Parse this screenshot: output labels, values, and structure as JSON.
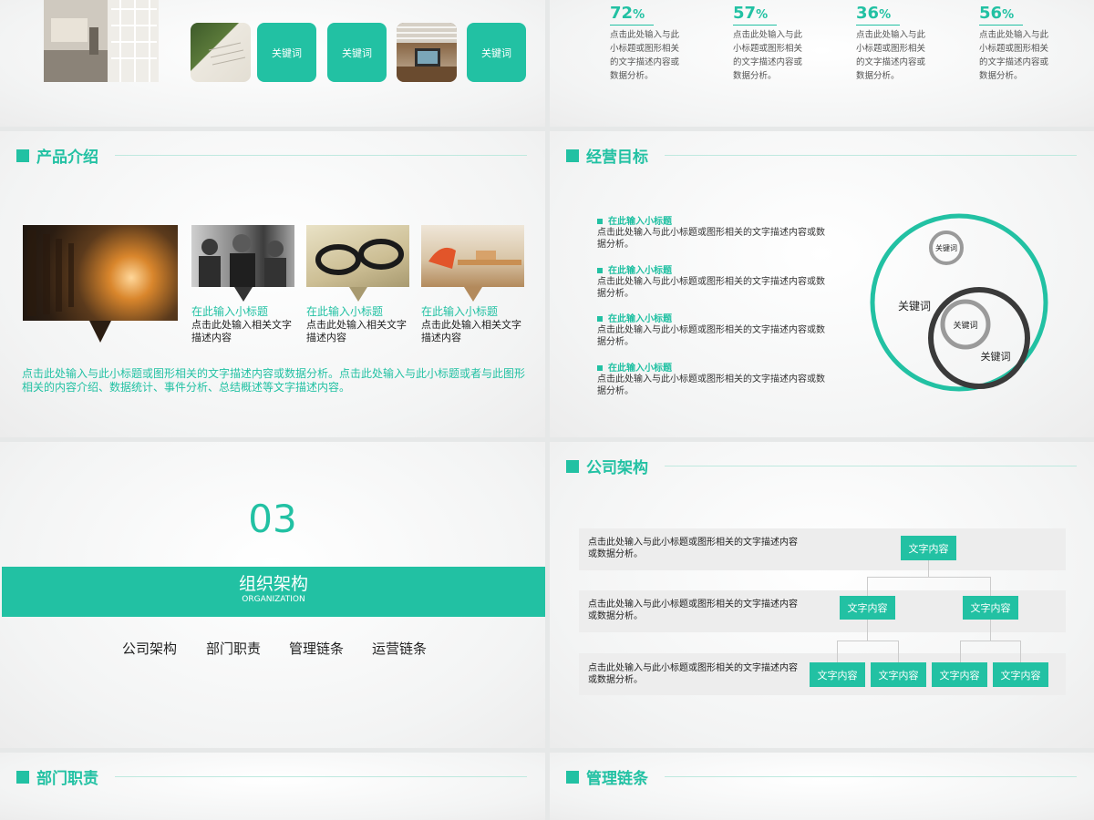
{
  "slide1": {
    "keywords": [
      "关键词",
      "关键词",
      "关键词"
    ]
  },
  "slide2": {
    "stats": [
      {
        "value": "72",
        "unit": "%",
        "desc": "点击此处输入与此小标题或图形相关的文字描述内容或数据分析。"
      },
      {
        "value": "57",
        "unit": "%",
        "desc": "点击此处输入与此小标题或图形相关的文字描述内容或数据分析。"
      },
      {
        "value": "36",
        "unit": "%",
        "desc": "点击此处输入与此小标题或图形相关的文字描述内容或数据分析。"
      },
      {
        "value": "56",
        "unit": "%",
        "desc": "点击此处输入与此小标题或图形相关的文字描述内容或数据分析。"
      }
    ]
  },
  "slide3": {
    "title": "产品介绍",
    "items": [
      {
        "title": "在此输入小标题",
        "desc": "点击此处输入相关文字描述内容"
      },
      {
        "title": "在此输入小标题",
        "desc": "点击此处输入相关文字描述内容"
      },
      {
        "title": "在此输入小标题",
        "desc": "点击此处输入相关文字描述内容"
      }
    ],
    "summary": "点击此处输入与此小标题或图形相关的文字描述内容或数据分析。点击此处输入与此小标题或者与此图形相关的内容介绍、数据统计、事件分析、总结概述等文字描述内容。"
  },
  "slide4": {
    "title": "经营目标",
    "items": [
      {
        "title": "在此输入小标题",
        "desc": "点击此处输入与此小标题或图形相关的文字描述内容或数据分析。"
      },
      {
        "title": "在此输入小标题",
        "desc": "点击此处输入与此小标题或图形相关的文字描述内容或数据分析。"
      },
      {
        "title": "在此输入小标题",
        "desc": "点击此处输入与此小标题或图形相关的文字描述内容或数据分析。"
      },
      {
        "title": "在此输入小标题",
        "desc": "点击此处输入与此小标题或图形相关的文字描述内容或数据分析。"
      }
    ],
    "circle_labels": [
      "关键词",
      "关键词",
      "关键词",
      "关键词"
    ],
    "colors": {
      "accent": "#22c1a3",
      "dark": "#3a3a3a",
      "grey": "#9a9a9a"
    }
  },
  "slide5": {
    "number": "03",
    "title": "组织架构",
    "subtitle": "ORGANIZATION",
    "links": [
      "公司架构",
      "部门职责",
      "管理链条",
      "运营链条"
    ]
  },
  "slide6": {
    "title": "公司架构",
    "rows": [
      "点击此处输入与此小标题或图形相关的文字描述内容或数据分析。",
      "点击此处输入与此小标题或图形相关的文字描述内容或数据分析。",
      "点击此处输入与此小标题或图形相关的文字描述内容或数据分析。"
    ],
    "boxes": {
      "top": "文字内容",
      "mid": [
        "文字内容",
        "文字内容"
      ],
      "bottom": [
        "文字内容",
        "文字内容",
        "文字内容",
        "文字内容"
      ]
    }
  },
  "slide7": {
    "title": "部门职责"
  },
  "slide8": {
    "title": "管理链条"
  },
  "colors": {
    "accent": "#22c1a3",
    "background": "#f3f4f4"
  }
}
